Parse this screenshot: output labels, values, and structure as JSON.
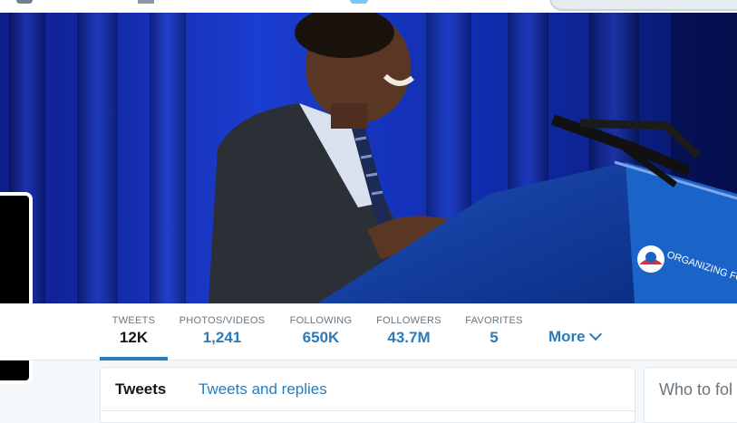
{
  "header": {
    "banner_alt": "Profile header photo",
    "podium_text": "ORGANIZING FOR"
  },
  "profile_nav": {
    "stats": [
      {
        "label": "TWEETS",
        "value": "12K",
        "active": true
      },
      {
        "label": "PHOTOS/VIDEOS",
        "value": "1,241",
        "active": false
      },
      {
        "label": "FOLLOWING",
        "value": "650K",
        "active": false
      },
      {
        "label": "FOLLOWERS",
        "value": "43.7M",
        "active": false
      },
      {
        "label": "FAVORITES",
        "value": "5",
        "active": false
      }
    ],
    "more_label": "More"
  },
  "timeline": {
    "tabs": [
      {
        "label": "Tweets",
        "active": true
      },
      {
        "label": "Tweets and replies",
        "active": false
      }
    ]
  },
  "sidebar": {
    "who_to_follow_title": "Who to fol"
  },
  "colors": {
    "link": "#2b7bb9",
    "text": "#14171a",
    "muted": "#66757f",
    "background": "#f5f8fa"
  }
}
